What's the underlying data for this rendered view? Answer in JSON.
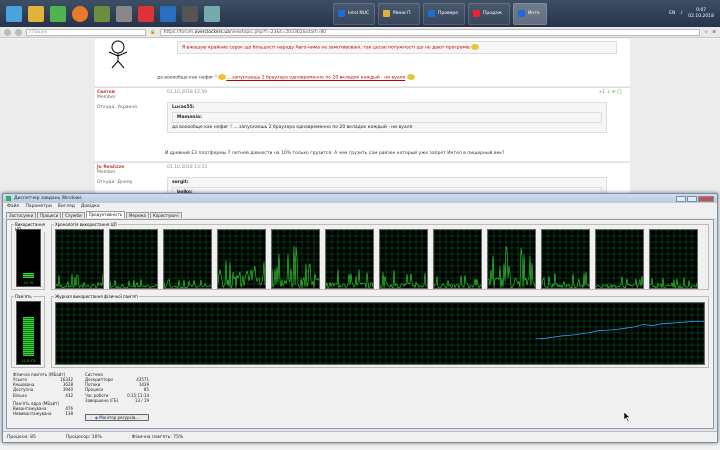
{
  "taskbar": {
    "tabs": [
      {
        "label": "Intel NUC"
      },
      {
        "label": "Мини П"
      },
      {
        "label": "Провере"
      },
      {
        "label": "Продаж"
      },
      {
        "label": "Инте"
      }
    ],
    "lang": "EN",
    "time": "0:07",
    "date": "02.10.2018"
  },
  "browser": {
    "search_placeholder": "Пошук",
    "url_prefix": "https://forum.",
    "url_host": "overclockers.ua",
    "url_rest": "/viewtopic.php?f=23&t=203362&start=80"
  },
  "forum": {
    "post1": {
      "quote_text": "Я вжашую крайние сорок що більшості народу Авго-нима не замотивовані, так цесае потужності що не дают прогромів",
      "text": "да вооообще как нефиг ! ",
      "text_tail": "....запускаешь 2 браузера одновременно по 20 вкладок каждый - ни вуаля"
    },
    "post2": {
      "author": "Святой",
      "role": "Member",
      "from": "Откуда: Украина",
      "date": "01.10.2018 12:59",
      "quote_by": "Lucas55:",
      "inner_quote_by": "Mamonia:",
      "quote_text": "да вооообще как нефиг ! ....запускаешь 2 браузера одновременно по 20 вкладок каждый - ни вуаля",
      "text": "И древний E3 платформы 7 летней давности на 10% только грузится. А чем грузить сам райзен который уже запрет Интел в пищерный век?",
      "vote": "+1"
    },
    "post3": {
      "author": "Jo Realizze",
      "role": "Member",
      "from": "Откуда: Днепр",
      "date": "01.10.2018 13:53",
      "quote_by": "sergit:",
      "inner_quote_by": "bolko:"
    }
  },
  "taskmgr": {
    "title": "Диспетчер завдань Windows",
    "menu": [
      "Файл",
      "Параметри",
      "Вигляд",
      "Довідка"
    ],
    "tabs": [
      "Застосунки",
      "Процеси",
      "Служби",
      "Продуктивність",
      "Мережа",
      "Користувачі"
    ],
    "active_tab": 3,
    "cpu_usage_label": "Використання ЦП",
    "cpu_usage_value": "10 %",
    "cpu_usage_fraction": 0.1,
    "cpu_history_label": "Хронологія використання ЦП",
    "mem_label": "Пам'ять",
    "mem_value": "11,8 ГБ",
    "mem_fraction": 0.75,
    "mem_history_label": "Журнал використання фізичної пам'яті",
    "physical": {
      "title": "Фізична пам'ять (МБайт)",
      "rows": [
        {
          "k": "Усього",
          "v": "16332"
        },
        {
          "k": "Кешована",
          "v": "3628"
        },
        {
          "k": "Доступна",
          "v": "3940"
        },
        {
          "k": "Вільна",
          "v": "432"
        }
      ]
    },
    "kernel": {
      "title": "Пам'ять ядра (МБайт)",
      "rows": [
        {
          "k": "Вивантажувана",
          "v": "476"
        },
        {
          "k": "Невивантажувана",
          "v": "138"
        }
      ]
    },
    "system": {
      "title": "Система",
      "rows": [
        {
          "k": "Дескриптори",
          "v": "43571"
        },
        {
          "k": "Потоки",
          "v": "1439"
        },
        {
          "k": "Процеси",
          "v": "85"
        },
        {
          "k": "Час роботи",
          "v": "0:15:11:14"
        },
        {
          "k": "Завершено (ГБ)",
          "v": "13 / 19"
        }
      ]
    },
    "resource_button": "Монітор ресурсів...",
    "status": {
      "processes": "Процеси: 85",
      "cpu": "Процесор: 10%",
      "memory": "Фізична пам'ять: 75%"
    },
    "mem_history": [
      0.43,
      0.44,
      0.46,
      0.48,
      0.49,
      0.51,
      0.53,
      0.56,
      0.57,
      0.58,
      0.6,
      0.62,
      0.66,
      0.64,
      0.67,
      0.68,
      0.69,
      0.7,
      0.71,
      0.71
    ],
    "cpu_cores": 12,
    "colors": {
      "graph_green": "#33dd33",
      "graph_blue": "#3399ff",
      "grid": "#0a6a2a"
    }
  }
}
